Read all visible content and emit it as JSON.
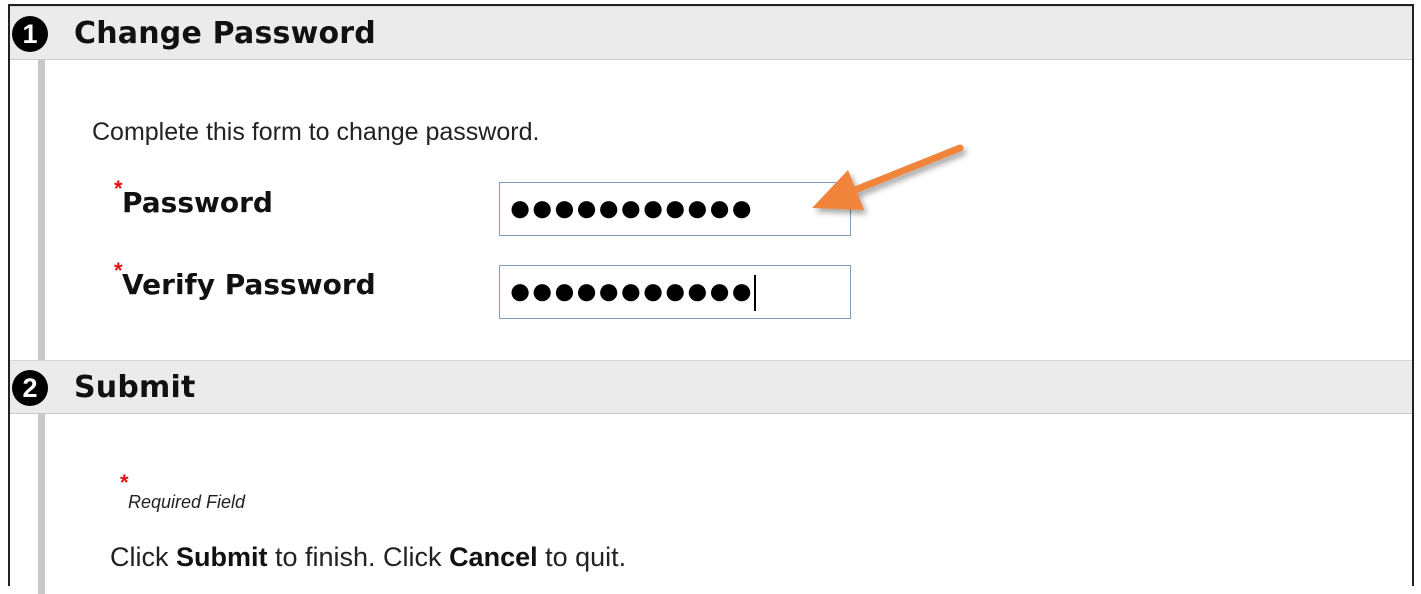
{
  "section1": {
    "number": "1",
    "title": "Change Password",
    "intro": "Complete this form to change password."
  },
  "fields": {
    "password_label": "Password",
    "password_value": "●●●●●●●●●●●",
    "verify_label": "Verify Password",
    "verify_value": "●●●●●●●●●●●",
    "required_marker": "*"
  },
  "section2": {
    "number": "2",
    "title": "Submit",
    "required_field_note": "Required Field",
    "finish_prefix": "Click ",
    "submit_word": "Submit",
    "finish_middle": " to finish. Click ",
    "cancel_word": "Cancel",
    "finish_suffix": " to quit."
  },
  "colors": {
    "required": "#e01010",
    "arrow": "#f0843a",
    "header_bg": "#ebebeb",
    "input_border": "#7f9db9"
  },
  "icons": {
    "step1": "step-number-1-icon",
    "step2": "step-number-2-icon",
    "annotation": "orange-arrow-icon"
  }
}
